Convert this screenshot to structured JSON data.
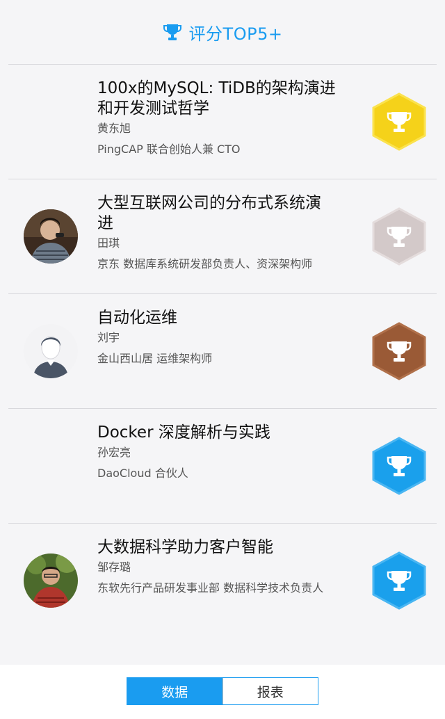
{
  "header": {
    "title": "评分TOP5+",
    "icon": "trophy-icon",
    "accent": "#1a9cf0"
  },
  "items": [
    {
      "title_line1": "100x的MySQL: TiDB的架构演进",
      "title_line2": "和开发测试哲学",
      "speaker": "黄东旭",
      "company": "PingCAP 联合创始人兼 CTO",
      "badge": "gold",
      "badge_color": "#f5d21a",
      "avatar": "blank"
    },
    {
      "title_line1": "大型互联网公司的分布式系统演",
      "title_line2": "进",
      "speaker": "田琪",
      "company": "京东 数据库系统研发部负责人、资深架构师",
      "badge": "silver",
      "badge_color": "#d3c9c9",
      "avatar": "photo"
    },
    {
      "title_line1": "自动化运维",
      "title_line2": "",
      "speaker": "刘宇",
      "company": "金山西山居 运维架构师",
      "badge": "bronze",
      "badge_color": "#9a5a36",
      "avatar": "placeholder"
    },
    {
      "title_line1": "Docker 深度解析与实践",
      "title_line2": "",
      "speaker": "孙宏亮",
      "company": "DaoCloud 合伙人",
      "badge": "blue",
      "badge_color": "#1aa0ec",
      "avatar": "blank"
    },
    {
      "title_line1": "大数据科学助力客户智能",
      "title_line2": "",
      "speaker": "邹存璐",
      "company": "东软先行产品研发事业部 数据科学技术负责人",
      "badge": "blue",
      "badge_color": "#1aa0ec",
      "avatar": "photo"
    }
  ],
  "footer": {
    "tab_data": "数据",
    "tab_report": "报表",
    "active": "数据"
  }
}
